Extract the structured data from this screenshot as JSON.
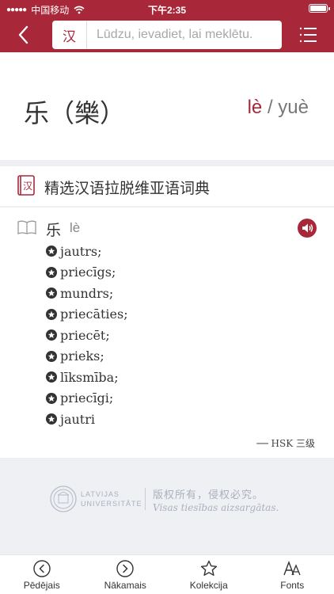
{
  "status": {
    "carrier": "中国移动",
    "time": "下午2:35"
  },
  "navbar": {
    "lang_label": "汉",
    "search_placeholder": "Lūdzu, ievadiet, lai meklētu."
  },
  "headword": {
    "hanzi": "乐（樂）",
    "pinyin_1": "lè",
    "separator": "/",
    "pinyin_2": "yuè"
  },
  "dictionary": {
    "icon_char": "汉",
    "title": "精选汉语拉脱维亚语词典"
  },
  "entry": {
    "hanzi": "乐",
    "pinyin": "lè",
    "senses": [
      "jautrs;",
      "priecīgs;",
      "mundrs;",
      "priecāties;",
      "priecēt;",
      "prieks;",
      "līksmība;",
      "priecīgi;",
      "jautri"
    ],
    "hsk_label": "── HSK 三级"
  },
  "footer": {
    "uni_line1": "LATVIJAS",
    "uni_line2": "UNIVERSITĀTE",
    "copyright_zh": "版权所有，侵权必究。",
    "copyright_lv": "Visas tiesības aizsargātas."
  },
  "tabs": [
    {
      "label": "Pēdējais",
      "icon": "chevron-left-circle-icon"
    },
    {
      "label": "Nākamais",
      "icon": "chevron-right-circle-icon"
    },
    {
      "label": "Kolekcija",
      "icon": "star-icon"
    },
    {
      "label": "Fonts",
      "icon": "font-size-icon"
    }
  ],
  "colors": {
    "brand": "#a8283a",
    "background_gray": "#eef0f4"
  }
}
